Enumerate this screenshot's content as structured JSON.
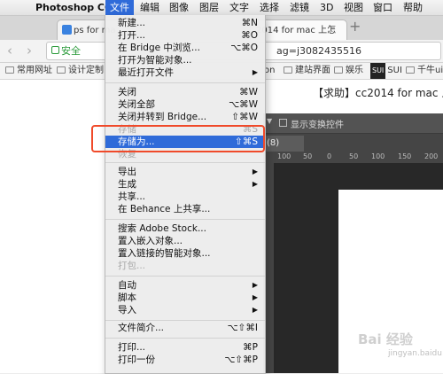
{
  "menubar": {
    "apple": "",
    "app_name": "Photoshop CC",
    "items": [
      "文件",
      "编辑",
      "图像",
      "图层",
      "文字",
      "选择",
      "滤镜",
      "3D",
      "视图",
      "窗口",
      "帮助"
    ]
  },
  "browser": {
    "tabs": [
      "ps for ma",
      "2014 for mac 上怎"
    ],
    "new_tab": "+",
    "back": "‹",
    "forward": "›",
    "secure_label": "安全",
    "url_tail": "ag=j3082435516",
    "bookmarks": [
      "常用网址",
      "设计定制",
      "on",
      "建站界面",
      "娱乐",
      "SUI",
      "千牛ui"
    ],
    "sui_badge": "SUI"
  },
  "page": {
    "title": "【求助】cc2014 for mac 上怎"
  },
  "photoshop": {
    "options_label": "显示变换控件",
    "doc_tab": "(8)",
    "ruler_ticks": [
      "100",
      "50",
      "0",
      "50",
      "100",
      "150",
      "200"
    ]
  },
  "file_menu": {
    "items": [
      {
        "label": "新建...",
        "shortcut": "⌘N"
      },
      {
        "label": "打开...",
        "shortcut": "⌘O"
      },
      {
        "label": "在 Bridge 中浏览...",
        "shortcut": "⌥⌘O"
      },
      {
        "label": "打开为智能对象..."
      },
      {
        "label": "最近打开文件",
        "submenu": "▶"
      },
      {
        "label": "关闭",
        "shortcut": "⌘W"
      },
      {
        "label": "关闭全部",
        "shortcut": "⌥⌘W"
      },
      {
        "label": "关闭并转到 Bridge...",
        "shortcut": "⇧⌘W"
      },
      {
        "label": "存储",
        "shortcut": "⌘S"
      },
      {
        "label": "存储为...",
        "shortcut": "⇧⌘S"
      },
      {
        "label": "恢复"
      },
      {
        "label": "导出",
        "submenu": "▶"
      },
      {
        "label": "生成",
        "submenu": "▶"
      },
      {
        "label": "共享..."
      },
      {
        "label": "在 Behance 上共享..."
      },
      {
        "label": "搜索 Adobe Stock..."
      },
      {
        "label": "置入嵌入对象..."
      },
      {
        "label": "置入链接的智能对象..."
      },
      {
        "label": "打包..."
      },
      {
        "label": "自动",
        "submenu": "▶"
      },
      {
        "label": "脚本",
        "submenu": "▶"
      },
      {
        "label": "导入",
        "submenu": "▶"
      },
      {
        "label": "文件简介...",
        "shortcut": "⌥⇧⌘I"
      },
      {
        "label": "打印...",
        "shortcut": "⌘P"
      },
      {
        "label": "打印一份",
        "shortcut": "⌥⇧⌘P"
      }
    ]
  },
  "watermark": {
    "main": "Bai 经验",
    "sub": "jingyan.baidu.com"
  }
}
